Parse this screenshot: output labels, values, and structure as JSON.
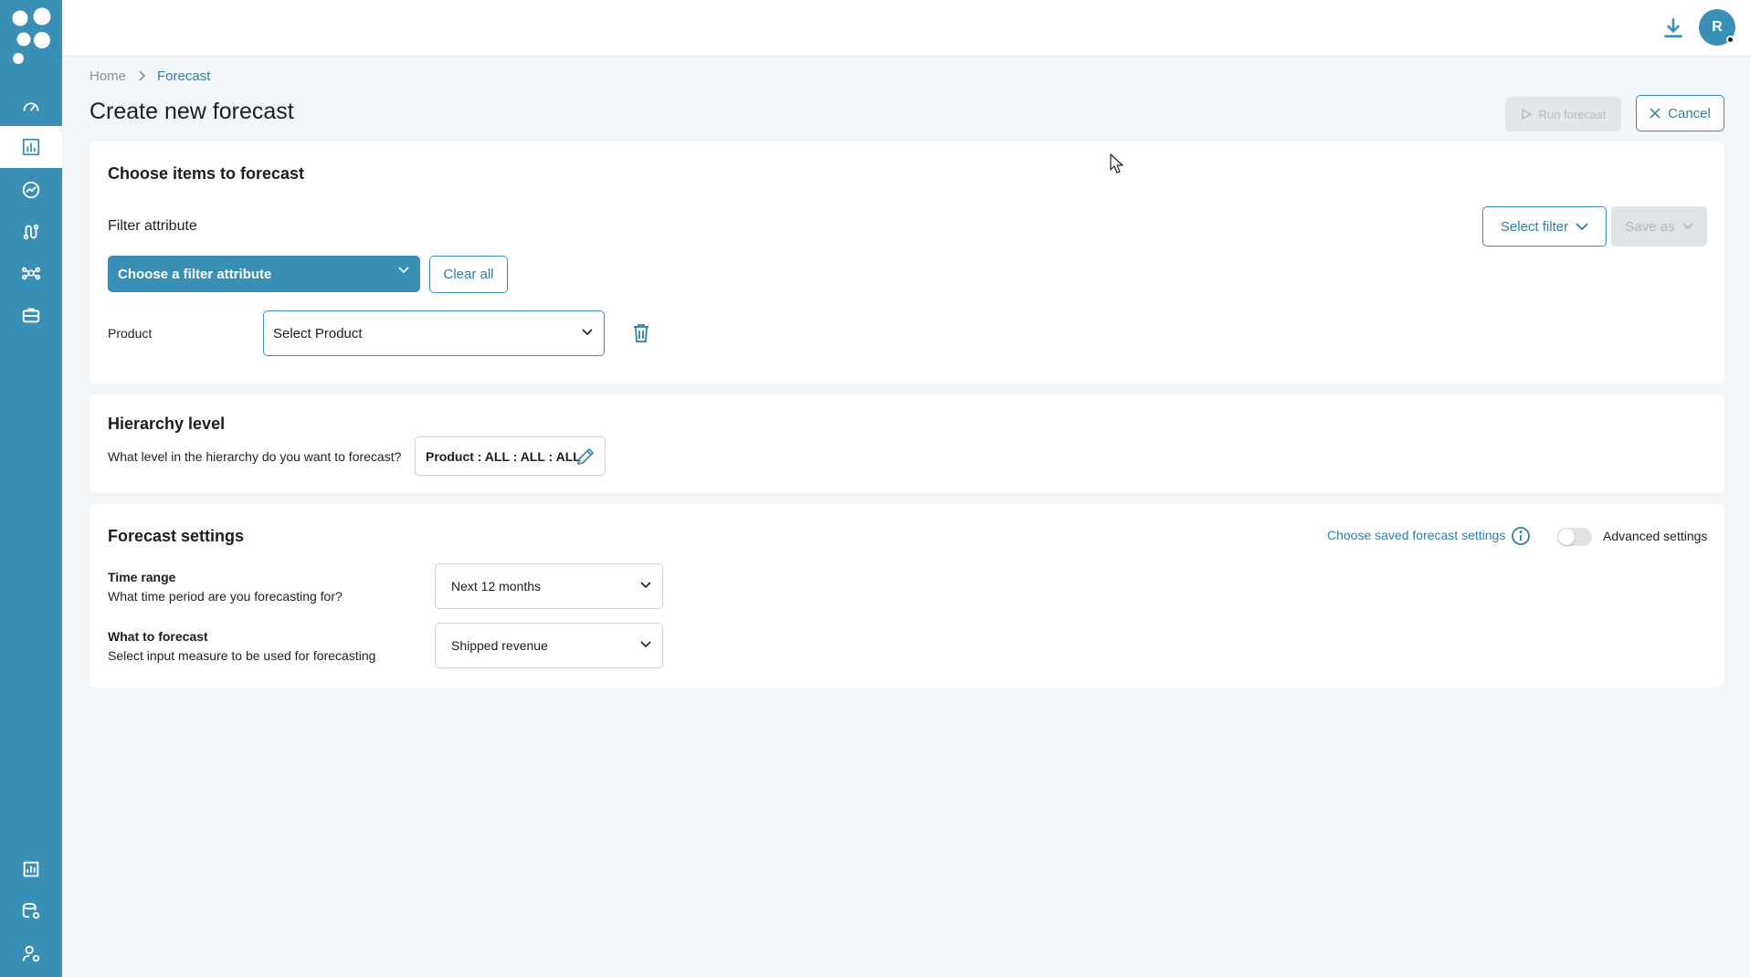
{
  "sidebar": {
    "logo_icon": "logo-icon",
    "items": [
      {
        "name": "dashboard",
        "icon": "gauge-icon"
      },
      {
        "name": "forecast",
        "icon": "bar-chart-icon",
        "active": true
      },
      {
        "name": "trends",
        "icon": "trend-circle-icon"
      },
      {
        "name": "routes",
        "icon": "route-icon"
      },
      {
        "name": "network",
        "icon": "network-icon"
      },
      {
        "name": "portfolio",
        "icon": "briefcase-icon"
      }
    ],
    "bottom_items": [
      {
        "name": "reports",
        "icon": "reports-icon"
      },
      {
        "name": "data-settings",
        "icon": "database-gear-icon"
      },
      {
        "name": "user-settings",
        "icon": "user-gear-icon"
      }
    ]
  },
  "topbar": {
    "avatar_initial": "R",
    "download_icon": "download-icon"
  },
  "breadcrumb": {
    "home": "Home",
    "current": "Forecast"
  },
  "page": {
    "title": "Create new forecast",
    "run_label": "Run forecast",
    "cancel_label": "Cancel"
  },
  "items_section": {
    "title": "Choose items to forecast",
    "filter_attribute_label": "Filter attribute",
    "select_filter_label": "Select filter",
    "save_as_label": "Save as",
    "filter_dropdown_label": "Choose a filter attribute",
    "clear_all_label": "Clear all",
    "filters": [
      {
        "label": "Product",
        "placeholder": "Select Product"
      }
    ]
  },
  "hierarchy": {
    "title": "Hierarchy level",
    "question": "What level in the hierarchy do you want to forecast?",
    "value": "Product : ALL : ALL : ALL"
  },
  "settings": {
    "title": "Forecast settings",
    "saved_link": "Choose saved forecast settings",
    "advanced_label": "Advanced settings",
    "advanced_on": false,
    "time_range": {
      "title": "Time range",
      "desc": "What time period are you forecasting for?",
      "value": "Next 12 months"
    },
    "what_to_forecast": {
      "title": "What to forecast",
      "desc": "Select input measure to be used for forecasting",
      "value": "Shipped revenue"
    }
  },
  "colors": {
    "primary": "#3a8fb7",
    "link": "#2f7fa6",
    "background": "#f3f6f9",
    "disabled": "#e4e7ea"
  }
}
